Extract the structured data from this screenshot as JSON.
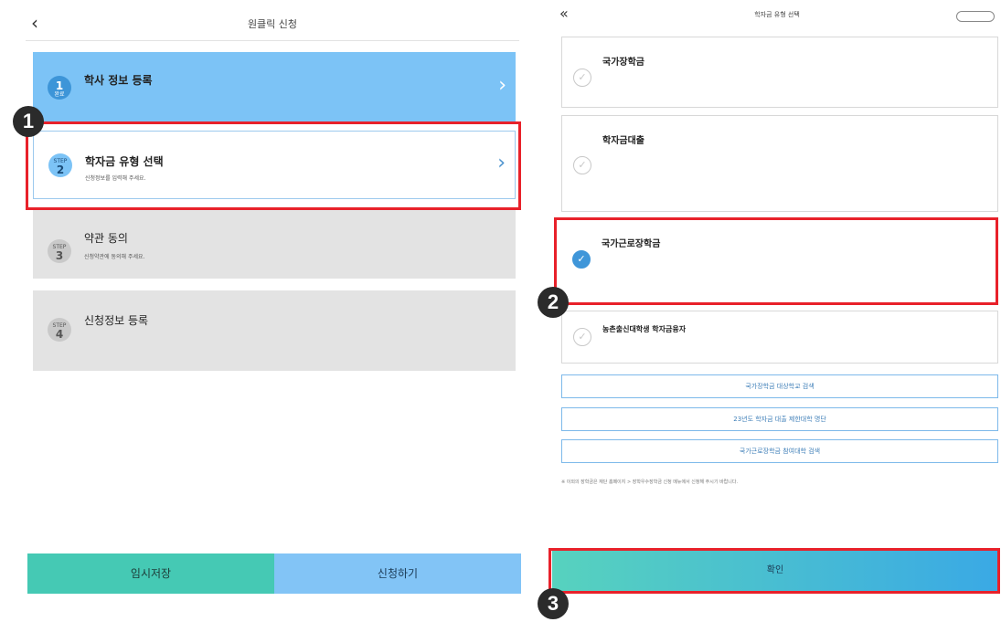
{
  "left": {
    "header": {
      "back_icon": "chevron-left-icon",
      "title": "원클릭 신청"
    },
    "steps": [
      {
        "badge_top": "1",
        "badge_bottom": "완료",
        "title": "학사 정보 등록",
        "subtitle": ""
      },
      {
        "badge_top": "STEP",
        "badge_bottom": "2",
        "title": "학자금 유형 선택",
        "subtitle": "신청정보를 입력해 주세요."
      },
      {
        "badge_top": "STEP",
        "badge_bottom": "3",
        "title": "약관 동의",
        "subtitle": "신청약관에 동의해 주세요."
      },
      {
        "badge_top": "STEP",
        "badge_bottom": "4",
        "title": "신청정보 등록",
        "subtitle": ""
      }
    ],
    "buttons": {
      "save": "임시저장",
      "apply": "신청하기"
    }
  },
  "right": {
    "header": {
      "back_icon": "double-chevron-left-icon",
      "title": "학자금 유형 선택",
      "pill": ""
    },
    "options": [
      {
        "label": "국가장학금",
        "selected": false
      },
      {
        "label": "학자금대출",
        "selected": false
      },
      {
        "label": "국가근로장학금",
        "selected": true
      },
      {
        "label": "농촌출신대학생 학자금융자",
        "selected": false
      }
    ],
    "links": [
      "국가장학금 대상학교 검색",
      "23년도 학자금 대출 제한대학 명단",
      "국가근로장학금 참여대학 검색"
    ],
    "note": "※ 이외의 장학금은 재단 홈페이지 > 장학우수장학금 신청 메뉴에서 신청해 주시기 바랍니다.",
    "confirm": "확인"
  },
  "markers": [
    "1",
    "2",
    "3"
  ],
  "colors": {
    "highlight": "#e8212a",
    "active_blue": "#7cc3f6",
    "teal": "#45c9b4",
    "radio_on": "#3f96d9"
  }
}
